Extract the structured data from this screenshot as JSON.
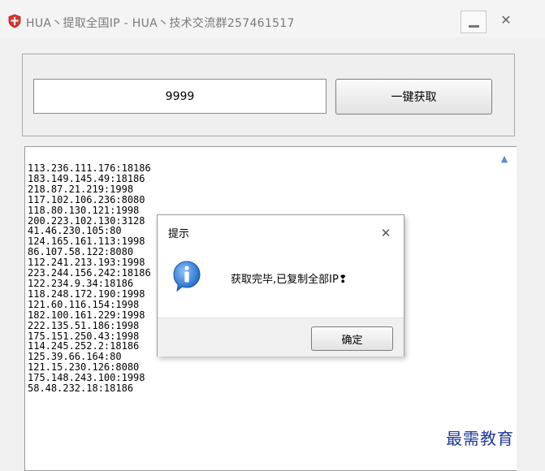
{
  "window": {
    "icon": "shield-icon",
    "title": "HUA丶提取全国IP  - HUA丶技术交流群257461517",
    "minimize_icon": "minimize-icon",
    "close_glyph": "✕"
  },
  "form": {
    "count_value": "9999",
    "get_button_label": "一键获取"
  },
  "ip_list": [
    "113.236.111.176:18186",
    "183.149.145.49:18186",
    "218.87.21.219:1998",
    "117.102.106.236:8080",
    "118.80.130.121:1998",
    "200.223.102.130:3128",
    "41.46.230.105:80",
    "124.165.161.113:1998",
    "86.107.58.122:8080",
    "112.241.213.193:1998",
    "223.244.156.242:18186",
    "122.234.9.34:18186",
    "118.248.172.190:1998",
    "121.60.116.154:1998",
    "182.100.161.229:1998",
    "222.135.51.186:1998",
    "175.151.250.43:1998",
    "114.245.252.2:18186",
    "125.39.66.164:80",
    "121.15.230.126:8080",
    "175.148.243.100:1998",
    "58.48.232.18:18186"
  ],
  "dialog": {
    "title": "提示",
    "close_glyph": "✕",
    "icon": "info-icon",
    "message": "获取完毕,已复制全部IP❢",
    "ok_label": "确定"
  },
  "watermark": "最需教育",
  "colors": {
    "accent_blue": "#2f7fd6",
    "shield_red": "#d9372f",
    "watermark_blue": "#1d3a9c"
  }
}
